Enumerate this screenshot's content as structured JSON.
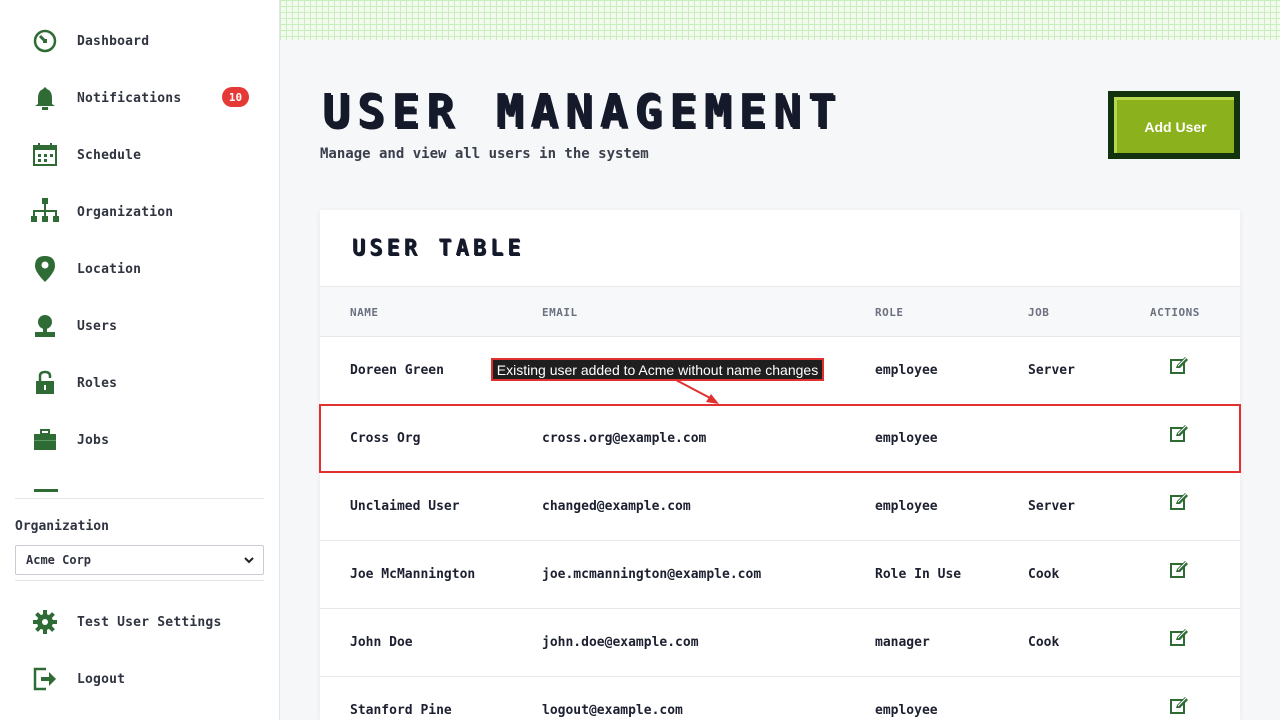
{
  "sidebar": {
    "items": [
      {
        "label": "Dashboard",
        "icon": "dashboard-gauge-icon"
      },
      {
        "label": "Notifications",
        "icon": "bell-icon",
        "badge": "10"
      },
      {
        "label": "Schedule",
        "icon": "calendar-icon"
      },
      {
        "label": "Organization",
        "icon": "org-chart-icon"
      },
      {
        "label": "Location",
        "icon": "map-pin-icon"
      },
      {
        "label": "Users",
        "icon": "user-icon"
      },
      {
        "label": "Roles",
        "icon": "unlocked-padlock-icon"
      },
      {
        "label": "Jobs",
        "icon": "briefcase-icon"
      }
    ],
    "organization_label": "Organization",
    "organization_selected": "Acme Corp",
    "footer_items": [
      {
        "label": "Test User Settings",
        "icon": "gear-icon"
      },
      {
        "label": "Logout",
        "icon": "logout-icon"
      }
    ]
  },
  "header": {
    "title": "USER MANAGEMENT",
    "subtitle": "Manage and view all users in the system",
    "add_user_label": "Add User"
  },
  "table": {
    "title": "USER TABLE",
    "columns": [
      "NAME",
      "EMAIL",
      "ROLE",
      "JOB",
      "ACTIONS"
    ],
    "rows": [
      {
        "name": "Doreen Green",
        "email": "",
        "role": "employee",
        "job": "Server"
      },
      {
        "name": "Cross Org",
        "email": "cross.org@example.com",
        "role": "employee",
        "job": ""
      },
      {
        "name": "Unclaimed User",
        "email": "changed@example.com",
        "role": "employee",
        "job": "Server"
      },
      {
        "name": "Joe McMannington",
        "email": "joe.mcmannington@example.com",
        "role": "Role In Use",
        "job": "Cook"
      },
      {
        "name": "John Doe",
        "email": "john.doe@example.com",
        "role": "manager",
        "job": "Cook"
      },
      {
        "name": "Stanford Pine",
        "email": "logout@example.com",
        "role": "employee",
        "job": ""
      }
    ]
  },
  "annotation": {
    "text": "Existing user added to Acme without name changes",
    "color": "#e03030"
  },
  "colors": {
    "icon_green": "#2e6b35",
    "add_button": "#8bb21c",
    "badge": "#e53935"
  }
}
